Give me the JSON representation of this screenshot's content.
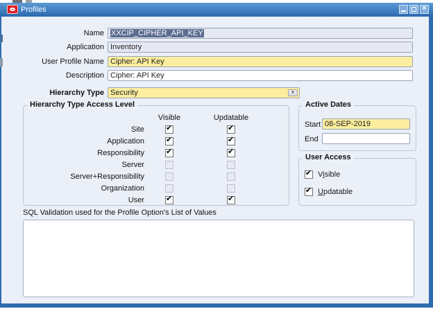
{
  "window": {
    "title": "Profiles"
  },
  "icons": {
    "checkmark": "✔",
    "dropdown_arrow": "▼",
    "close_glyph": "×"
  },
  "colors": {
    "titlebar_blue": "#3f7fc1",
    "window_background": "#ebeff7",
    "border_blue": "#2f6bb0",
    "required_field_yellow": "#fcee9e",
    "readonly_field_gray": "#e6e9f3",
    "selection_blue": "#5c6b90",
    "oracle_logo_red": "#e01e25"
  },
  "fields": {
    "name": {
      "label": "Name",
      "value": "XXCIP_CIPHER_API_KEY"
    },
    "application": {
      "label": "Application",
      "value": "Inventory"
    },
    "user_profile_name": {
      "label": "User Profile Name",
      "value": "Cipher: API Key"
    },
    "description": {
      "label": "Description",
      "value": "Cipher: API Key"
    },
    "hierarchy_type": {
      "label": "Hierarchy Type",
      "value": "Security"
    }
  },
  "access_level": {
    "title": "Hierarchy Type Access Level",
    "columns": [
      "Visible",
      "Updatable"
    ],
    "rows": [
      {
        "label": "Site",
        "visible": true,
        "updatable": true,
        "enabled": true
      },
      {
        "label": "Application",
        "visible": true,
        "updatable": true,
        "enabled": true
      },
      {
        "label": "Responsibility",
        "visible": true,
        "updatable": true,
        "enabled": true
      },
      {
        "label": "Server",
        "visible": false,
        "updatable": false,
        "enabled": false
      },
      {
        "label": "Server+Responsibility",
        "visible": false,
        "updatable": false,
        "enabled": false
      },
      {
        "label": "Organization",
        "visible": false,
        "updatable": false,
        "enabled": false
      },
      {
        "label": "User",
        "visible": true,
        "updatable": true,
        "enabled": true
      }
    ]
  },
  "active_dates": {
    "title": "Active Dates",
    "start": {
      "label": "Start",
      "value": "08-SEP-2019"
    },
    "end": {
      "label": "End",
      "value": ""
    }
  },
  "user_access": {
    "title": "User Access",
    "visible": {
      "label": "Visible",
      "checked": true,
      "underline_index": 1
    },
    "updatable": {
      "label": "Updatable",
      "checked": true,
      "underline_index": 0
    }
  },
  "sql_validation": {
    "label": "SQL Validation used for the Profile Option's List of Values",
    "value": ""
  }
}
